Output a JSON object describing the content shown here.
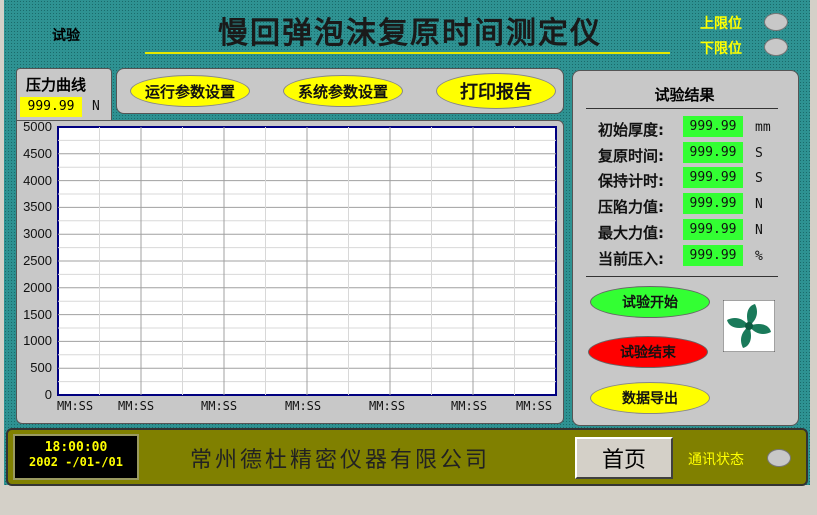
{
  "header": {
    "title": "慢回弹泡沫复原时间测定仪",
    "test_label": "试验",
    "upper_limit_label": "上限位",
    "lower_limit_label": "下限位"
  },
  "pressure_curve": {
    "tab_label": "压力曲线",
    "value": "999.99",
    "unit": "N"
  },
  "toolbar": {
    "run_params_label": "运行参数设置",
    "system_params_label": "系统参数设置",
    "print_report_label": "打印报告"
  },
  "results": {
    "title": "试验结果",
    "rows": [
      {
        "label": "初始厚度:",
        "value": "999.99",
        "unit": "mm"
      },
      {
        "label": "复原时间:",
        "value": "999.99",
        "unit": "S"
      },
      {
        "label": "保持计时:",
        "value": "999.99",
        "unit": "S"
      },
      {
        "label": "压陷力值:",
        "value": "999.99",
        "unit": "N"
      },
      {
        "label": "最大力值:",
        "value": "999.99",
        "unit": "N"
      },
      {
        "label": "当前压入:",
        "value": "999.99",
        "unit": "%"
      }
    ],
    "start_label": "试验开始",
    "stop_label": "试验结束",
    "export_label": "数据导出"
  },
  "chart_data": {
    "type": "line",
    "ylim": [
      0,
      5000
    ],
    "yticks": [
      "5000",
      "4500",
      "4000",
      "3500",
      "3000",
      "2500",
      "2000",
      "1500",
      "1000",
      "500",
      "0"
    ],
    "xticks": [
      "MM:SS",
      "MM:SS",
      "MM:SS",
      "MM:SS",
      "MM:SS",
      "MM:SS",
      "MM:SS"
    ],
    "series": [],
    "grid": true
  },
  "footer": {
    "time": "18:00:00",
    "date": "2002 -/01-/01",
    "company": "常州德杜精密仪器有限公司",
    "home_label": "首页",
    "comm_status_label": "通讯状态"
  },
  "colors": {
    "background": "#2e9292",
    "panel": "#c8c8c8",
    "value_green": "#33ff33",
    "button_yellow": "#ffff00",
    "start_green": "#33ff33",
    "stop_red": "#ff0000",
    "footer_olive": "#808000"
  }
}
